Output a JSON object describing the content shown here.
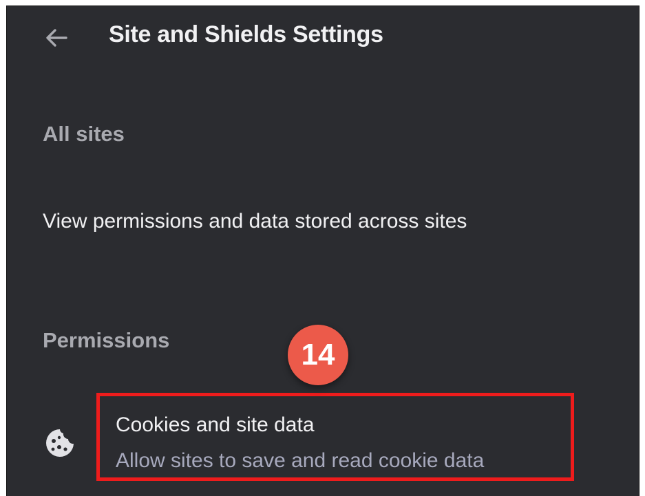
{
  "header": {
    "back_icon": "arrow-back-icon",
    "title": "Site and Shields Settings"
  },
  "all_sites": {
    "heading": "All sites",
    "row_label": "View permissions and data stored across sites"
  },
  "permissions": {
    "heading": "Permissions",
    "items": [
      {
        "icon": "cookie-icon",
        "title": "Cookies and site data",
        "subtitle": "Allow sites to save and read cookie data"
      }
    ]
  },
  "annotation": {
    "step_number": "14",
    "highlight_color": "#ee1c1c",
    "badge_color": "#ec5a4a"
  },
  "colors": {
    "background": "#2b2c30",
    "primary_text": "#f1f1f3",
    "secondary_text": "#a9aab0",
    "subtitle_text": "#a7a9bd"
  }
}
